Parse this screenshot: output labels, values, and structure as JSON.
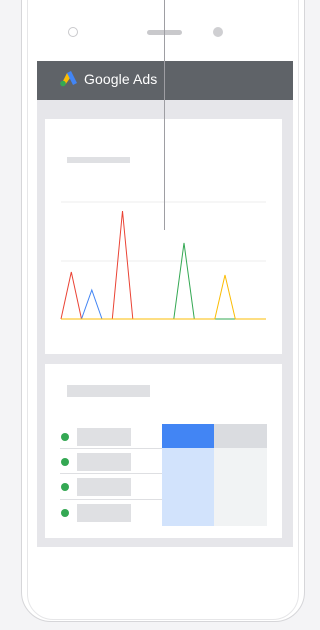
{
  "app": {
    "brand_label": "Google Ads"
  },
  "colors": {
    "appbar": "#5f6368",
    "logo_blue": "#4285f4",
    "logo_yellow": "#fbbc04",
    "logo_green": "#34a853",
    "series_red": "#ea4335",
    "series_blue": "#4285f4",
    "series_green": "#34a853",
    "series_yellow": "#fbbc04",
    "row_status": "#34a853",
    "col_selected_head": "#4285f4",
    "col_selected_body": "#d2e3fc",
    "col_other_head": "#dadce0",
    "col_other_body": "#f1f3f4"
  },
  "icons": {
    "logo": "google-ads-logo"
  },
  "chart_data": {
    "type": "line",
    "series": [
      {
        "color": "red",
        "values": [
          0,
          47,
          0,
          0,
          0,
          0,
          108,
          0,
          0,
          0,
          0,
          0,
          0,
          0,
          0,
          0,
          0,
          0,
          0,
          0,
          0
        ]
      },
      {
        "color": "blue",
        "values": [
          0,
          0,
          0,
          29,
          0,
          0,
          0,
          0,
          0,
          0,
          0,
          0,
          0,
          0,
          0,
          0,
          0,
          0,
          0,
          0,
          0
        ]
      },
      {
        "color": "green",
        "values": [
          0,
          0,
          0,
          0,
          0,
          0,
          0,
          0,
          0,
          0,
          0,
          0,
          76,
          0,
          0,
          0,
          0,
          0,
          0,
          0,
          0
        ]
      },
      {
        "color": "yellow",
        "values": [
          0,
          0,
          0,
          0,
          0,
          0,
          0,
          0,
          0,
          0,
          0,
          0,
          0,
          0,
          0,
          0,
          44,
          0,
          0,
          0,
          0
        ]
      }
    ],
    "grid": true,
    "legend": "none"
  },
  "table": {
    "rows": [
      {
        "status": "active"
      },
      {
        "status": "active"
      },
      {
        "status": "active"
      },
      {
        "status": "active"
      }
    ],
    "columns": [
      {
        "state": "selected"
      },
      {
        "state": "default"
      }
    ]
  }
}
